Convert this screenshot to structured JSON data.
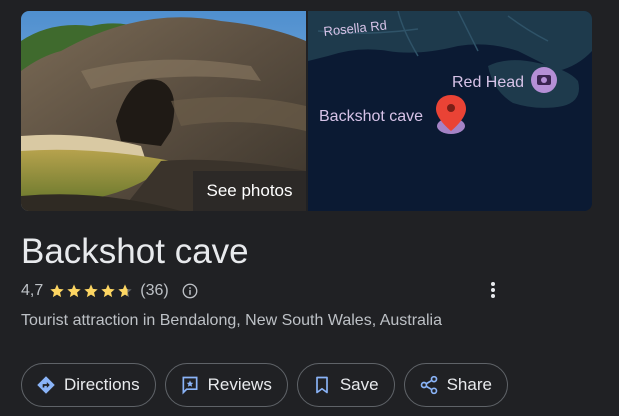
{
  "place": {
    "title": "Backshot cave",
    "rating": "4,7",
    "stars_filled": 4.7,
    "review_count": "(36)",
    "category": "Tourist attraction in Bendalong, New South Wales, Australia"
  },
  "media": {
    "see_photos_label": "See photos",
    "map_labels": {
      "road": "Rosella Rd",
      "landmark": "Red Head",
      "pin": "Backshot cave"
    }
  },
  "actions": [
    {
      "label": "Directions",
      "icon": "directions-icon"
    },
    {
      "label": "Reviews",
      "icon": "reviews-icon"
    },
    {
      "label": "Save",
      "icon": "bookmark-icon"
    },
    {
      "label": "Share",
      "icon": "share-icon"
    }
  ],
  "colors": {
    "background": "#202124",
    "text": "#e8eaed",
    "secondary_text": "#bdc1c6",
    "star": "#fdd663",
    "accent": "#8ab4f8",
    "pin": "#ea4335",
    "map_water": "#0b1a33",
    "map_land": "#1e3a4c"
  }
}
